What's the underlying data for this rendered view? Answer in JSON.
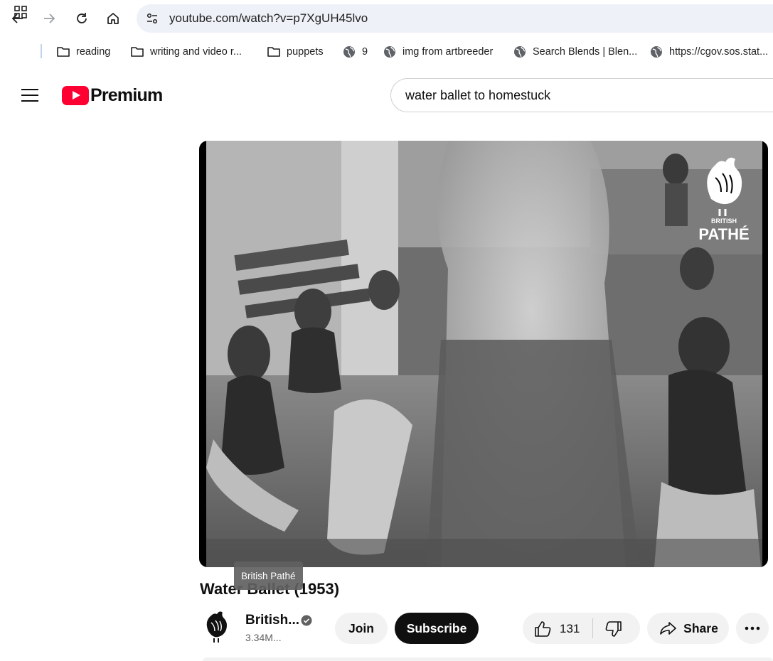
{
  "browser": {
    "url": "youtube.com/watch?v=p7XgUH45lvo",
    "bookmarks": [
      {
        "label": "reading",
        "icon": "folder-icon"
      },
      {
        "label": "writing and video r...",
        "icon": "folder-icon"
      },
      {
        "label": "puppets",
        "icon": "folder-icon"
      },
      {
        "label": "9",
        "icon": "globe-icon"
      },
      {
        "label": "img from artbreeder",
        "icon": "globe-icon"
      },
      {
        "label": "Search Blends | Blen...",
        "icon": "globe-icon"
      },
      {
        "label": "https://cgov.sos.stat...",
        "icon": "globe-icon"
      }
    ]
  },
  "header": {
    "logo_text": "Premium",
    "search_query": "water ballet to homestuck"
  },
  "player": {
    "watermark_line1": "BRITISH",
    "watermark_line2": "PATHÉ"
  },
  "tooltip": "British Pathé",
  "video": {
    "title": "Water Ballet (1953)",
    "channel_name": "British...",
    "subscribers": "3.34M...",
    "join_label": "Join",
    "subscribe_label": "Subscribe",
    "like_count": "131",
    "share_label": "Share"
  },
  "colors": {
    "brand_red": "#ff0033",
    "omnibox": "#eef1f7",
    "pill_bg": "#f2f2f2"
  }
}
